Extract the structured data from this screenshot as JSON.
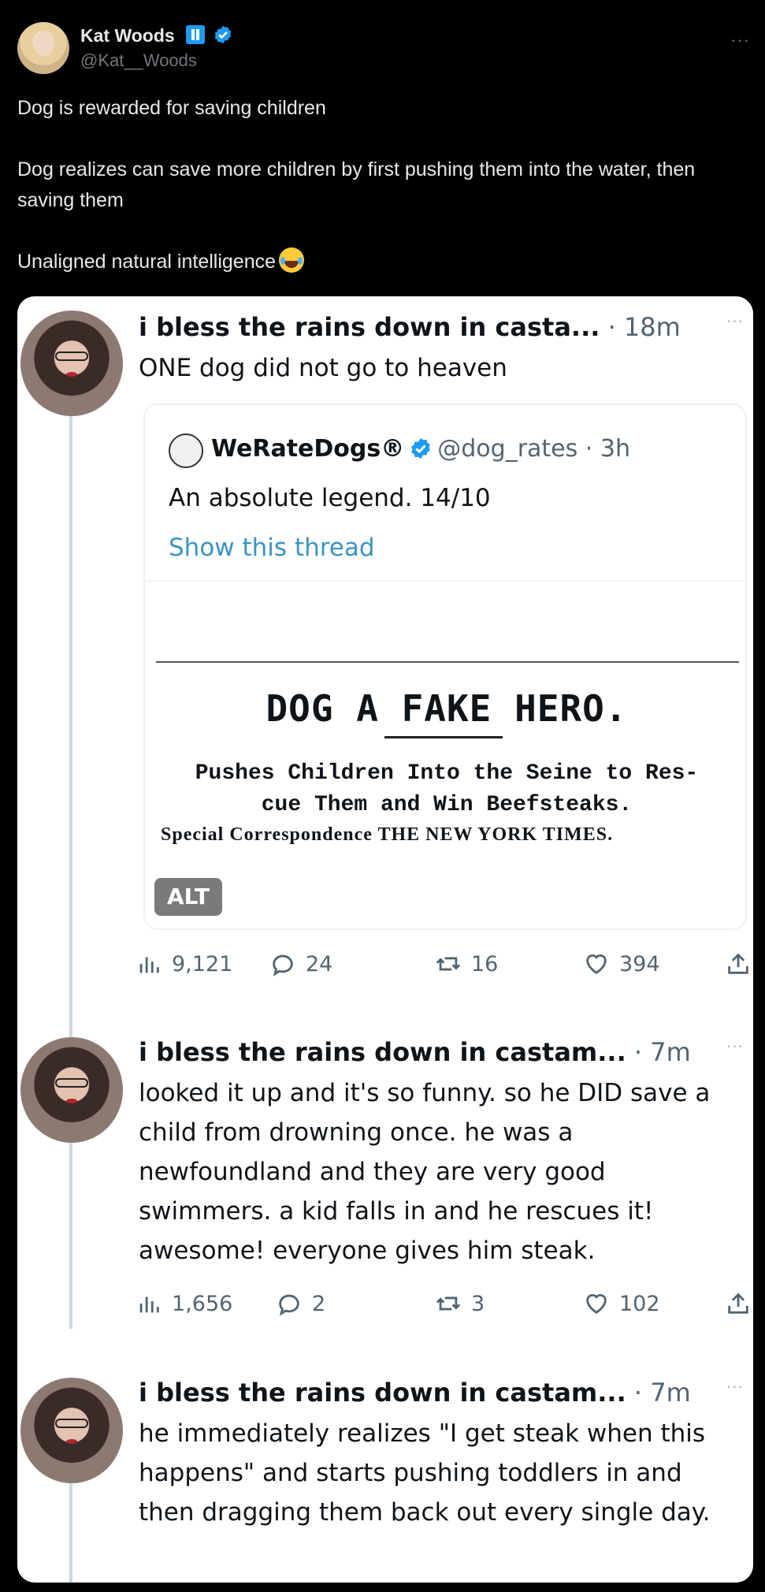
{
  "author": {
    "name": "Kat Woods",
    "handle": "@Kat__Woods"
  },
  "post": {
    "lines": [
      "Dog is rewarded for saving children",
      "Dog realizes can save more children by first pushing them into the water, then saving them",
      "Unaligned natural intelligence"
    ],
    "emoji": "face-with-tears-of-joy-icon"
  },
  "screenshot": {
    "first": {
      "name": "i bless the rains down in casta...",
      "time": "· 18m",
      "text": "ONE dog did not go to heaven",
      "quote": {
        "name": "WeRateDogs®",
        "handle": "@dog_rates · 3h",
        "text": "An absolute legend. 14/10",
        "link": "Show this thread",
        "headline": "DOG A FAKE HERO.",
        "subhead_1": "Pushes Children Into the Seine to Res-",
        "subhead_2": "cue Them and Win Beefsteaks.",
        "correspondence": "Special Correspondence THE NEW YORK TIMES.",
        "alt": "ALT"
      },
      "stats": {
        "views": "9,121",
        "replies": "24",
        "retweets": "16",
        "likes": "394"
      }
    },
    "second": {
      "name": "i bless the rains down in castam...",
      "time": "· 7m",
      "text": "looked it up and it's so funny. so he DID save a child from drowning once. he was a newfoundland and they are very good swimmers. a kid falls in and he rescues it! awesome! everyone gives him steak.",
      "stats": {
        "views": "1,656",
        "replies": "2",
        "retweets": "3",
        "likes": "102"
      }
    },
    "third": {
      "name": "i bless the rains down in castam...",
      "time": "· 7m",
      "text": "he immediately realizes \"I get steak when this happens\" and starts pushing toddlers in and then dragging them back out every single day."
    }
  }
}
